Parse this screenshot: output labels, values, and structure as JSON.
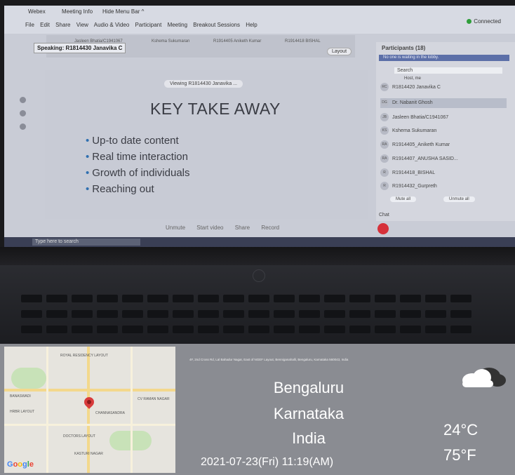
{
  "screen": {
    "app_title": "Webex",
    "meeting_info": "Meeting Info",
    "hide_menu": "Hide Menu Bar ^",
    "menus": [
      "File",
      "Edit",
      "Share",
      "View",
      "Audio & Video",
      "Participant",
      "Meeting",
      "Breakout Sessions",
      "Help"
    ],
    "connected": "Connected",
    "speaking": "Speaking: R1814430 Janavika C",
    "thumbs": [
      "Jasleen Bhatia/C1941067",
      "Kshema Sukumaran",
      "R1914405 Aniketh Kumar",
      "R1914418 BISHAL"
    ],
    "layout": "Layout",
    "viewing": "Viewing R1814430 Janavika ...",
    "slide_title": "KEY TAKE AWAY",
    "bullets": [
      "Up-to date content",
      "Real time interaction",
      "Growth of individuals",
      "Reaching out"
    ],
    "controls": [
      "Unmute",
      "Start video",
      "Share",
      "Record"
    ],
    "taskbar_search": "Type here to search",
    "participants": {
      "title": "Participants (18)",
      "waiting": "No one is waiting in the lobby.",
      "search": "Search",
      "host": "Host, me",
      "rows": [
        {
          "initials": "RC",
          "name": "R1814420 Janavika C"
        },
        {
          "initials": "DG",
          "name": "Dr. Nabanit Ghosh"
        },
        {
          "initials": "JB",
          "name": "Jasleen Bhatia/C1941067"
        },
        {
          "initials": "KS",
          "name": "Kshema Sukumaran"
        },
        {
          "initials": "RA",
          "name": "R1914405_Aniketh Kumar"
        },
        {
          "initials": "RA",
          "name": "R1914407_ANUSHA SASID..."
        },
        {
          "initials": "R",
          "name": "R1914418_BISHAL"
        },
        {
          "initials": "R",
          "name": "R1914432_Gurpreth"
        }
      ],
      "mute_all": "Mute all",
      "unmute_all": "Unmute all",
      "chat": "Chat"
    }
  },
  "overlay": {
    "address": "4F, 2nd Cross Rd, Lal Bahadur Nagar, East of NGEF Layout, Benniganahalli, Bengaluru, Karnataka 560043, India",
    "city": "Bengaluru",
    "state": "Karnataka",
    "country": "India",
    "datetime": "2021-07-23(Fri)   11:19(AM)",
    "temp_c": "24°C",
    "temp_f": "75°F",
    "weather_icon": "cloud-icon",
    "map_labels": [
      "ROYAL RESIDENCY LAYOUT",
      "BANASWADI",
      "HRBR LAYOUT",
      "CHANNASANDRA",
      "DOCTORS LAYOUT",
      "CV RAMAN NAGAR",
      "KASTURI NAGAR"
    ],
    "google": [
      "G",
      "o",
      "o",
      "g",
      "l",
      "e"
    ]
  }
}
